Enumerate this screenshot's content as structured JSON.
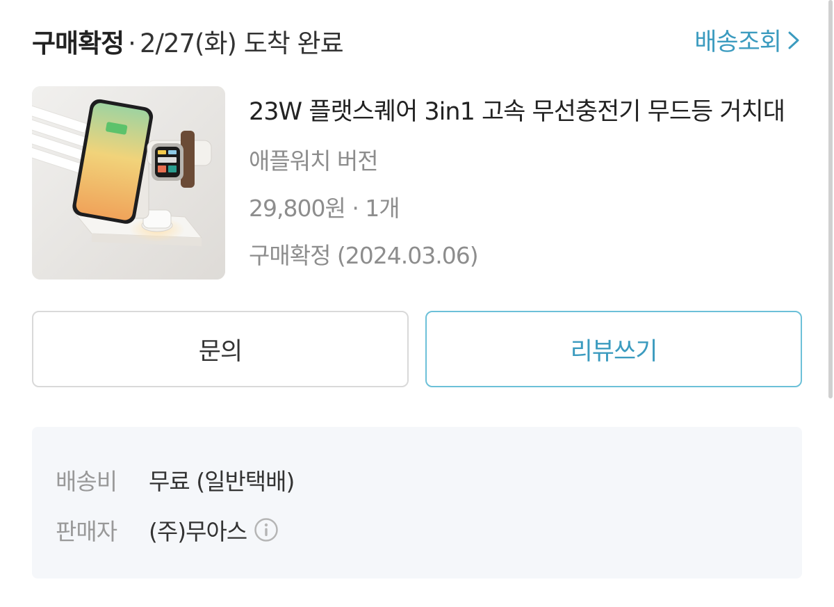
{
  "header": {
    "status": "구매확정",
    "separator": "·",
    "delivery": "2/27(화) 도착 완료",
    "track_label": "배송조회",
    "chevron_icon": "chevron-right-icon"
  },
  "product": {
    "title": "23W 플랫스퀘어 3in1 고속 무선충전기 무드등 거치대",
    "option": "애플워치 버전",
    "price_qty": "29,800원 · 1개",
    "confirm_date": "구매확정 (2024.03.06)"
  },
  "buttons": {
    "inquiry_label": "문의",
    "review_label": "리뷰쓰기"
  },
  "details": {
    "shipping_label": "배송비",
    "shipping_value": "무료 (일반택배)",
    "seller_label": "판매자",
    "seller_value": "(주)무아스",
    "info_icon": "info-icon"
  },
  "colors": {
    "accent": "#3b9bbf",
    "accent_border": "#6cc0d8",
    "detail_bg": "#f5f7fa",
    "muted_text": "#8d8d8d"
  }
}
